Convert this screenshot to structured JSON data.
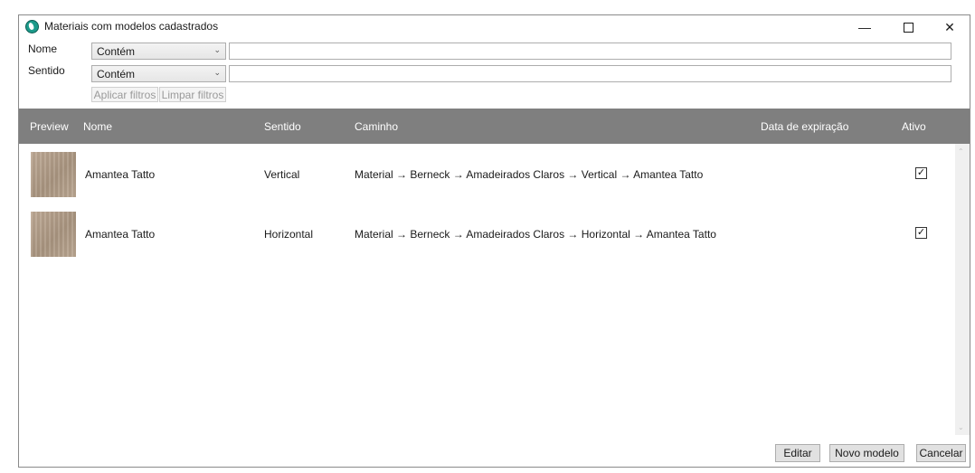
{
  "window": {
    "title": "Materiais com modelos cadastrados"
  },
  "filters": {
    "name_label": "Nome",
    "direction_label": "Sentido",
    "name_operator": "Contém",
    "direction_operator": "Contém",
    "name_value": "",
    "direction_value": "",
    "apply_label": "Aplicar filtros",
    "clear_label": "Limpar filtros"
  },
  "table": {
    "columns": [
      "Preview",
      "Nome",
      "Sentido",
      "Caminho",
      "Data de expiração",
      "Ativo"
    ],
    "rows": [
      {
        "nome": "Amantea Tatto",
        "sentido": "Vertical",
        "caminho": "Material → Berneck → Amadeirados Claros → Vertical → Amantea Tatto",
        "data": "",
        "ativo": true
      },
      {
        "nome": "Amantea Tatto",
        "sentido": "Horizontal",
        "caminho": "Material → Berneck → Amadeirados Claros → Horizontal → Amantea Tatto",
        "data": "",
        "ativo": true
      }
    ]
  },
  "actions": {
    "edit_label": "Editar",
    "new_label": "Novo modelo",
    "cancel_label": "Cancelar"
  },
  "glyphs": {
    "check": "✓",
    "chevron": "⌄"
  },
  "colors": {
    "header_bg": "#7f7f7f",
    "accent": "#1c9a8a"
  }
}
